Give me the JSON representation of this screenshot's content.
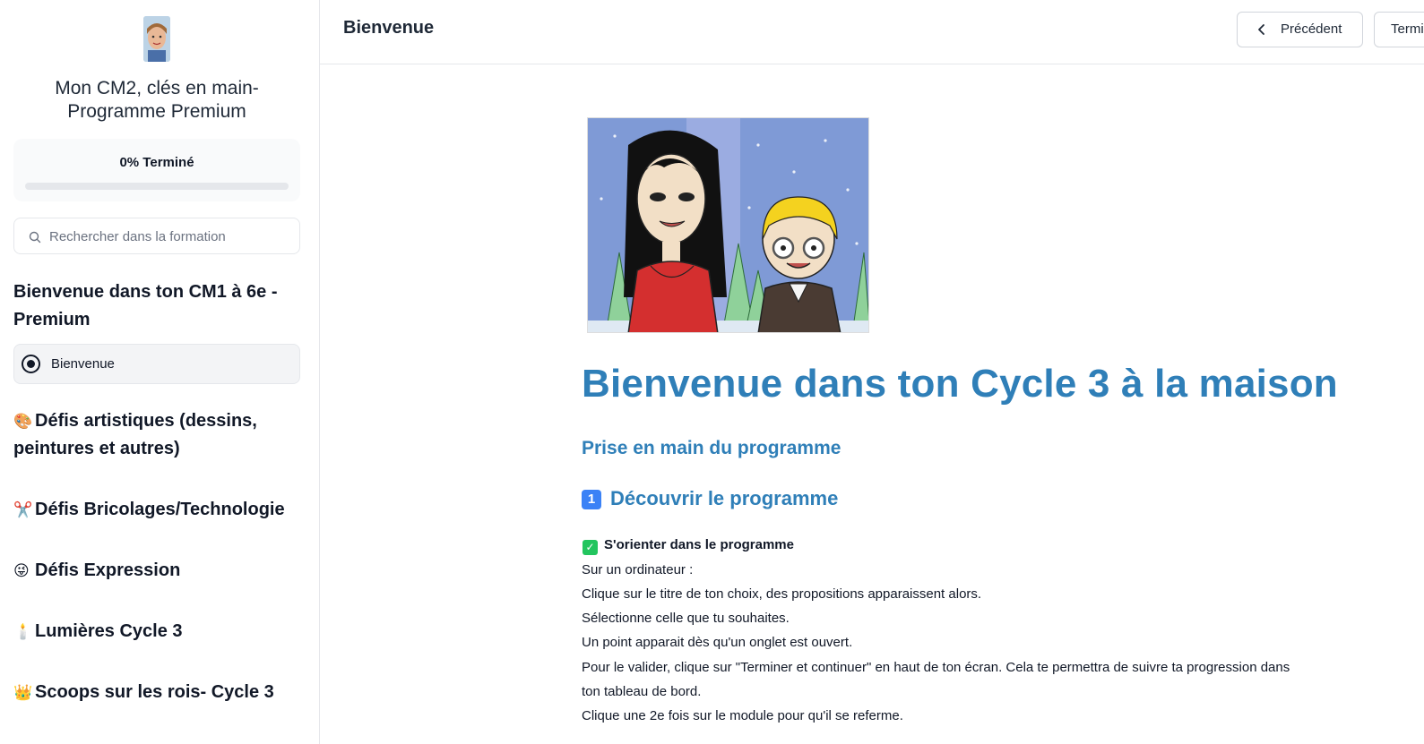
{
  "sidebar": {
    "course_title": "Mon CM2, clés en main- Programme Premium",
    "progress": {
      "label": "0% Terminé",
      "percent": 0
    },
    "search": {
      "placeholder": "Rechercher dans la formation"
    },
    "sections": [
      {
        "emoji": "",
        "title": "Bienvenue dans ton CM1 à 6e - Premium",
        "lessons": [
          {
            "label": "Bienvenue",
            "active": true
          }
        ]
      },
      {
        "emoji": "🎨",
        "title": "Défis artistiques (dessins, peintures et autres)"
      },
      {
        "emoji": "✂️",
        "title": "Défis Bricolages/Technologie"
      },
      {
        "emoji": "😜",
        "title": "Défis Expression"
      },
      {
        "emoji": "🕯️",
        "title": "Lumières Cycle 3"
      },
      {
        "emoji": "👑",
        "title": "Scoops sur les rois- Cycle 3"
      }
    ]
  },
  "header": {
    "title": "Bienvenue",
    "prev_label": "Précédent",
    "next_label": "Terminer et continuer"
  },
  "content": {
    "h1": "Bienvenue dans ton Cycle 3 à la maison",
    "h2": "Prise en main du programme",
    "h3_number": "1",
    "h3": "Découvrir le programme",
    "check_label": "S'orienter dans le programme",
    "paragraphs": [
      "Sur un ordinateur :",
      "Clique sur le titre de ton choix, des propositions apparaissent alors.",
      "Sélectionne celle que tu souhaites.",
      "Un point apparait dès qu'un onglet est ouvert.",
      "Pour le valider, clique sur \"Terminer et continuer\" en haut de ton écran. Cela te permettra de suivre ta progression dans",
      "ton tableau de bord.",
      "Clique une 2e fois sur le module pour qu'il se referme."
    ]
  },
  "colors": {
    "heading_blue": "#2f7fb8",
    "progress_fill": "#3b82f6",
    "border": "#e5e7eb"
  }
}
